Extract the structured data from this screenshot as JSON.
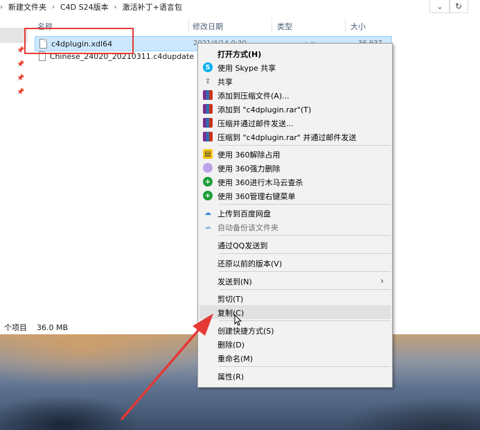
{
  "breadcrumb": {
    "items": [
      "新建文件夹",
      "C4D S24版本",
      "激活补丁+语言包"
    ]
  },
  "columns": {
    "name": "名称",
    "date": "修改日期",
    "type": "类型",
    "size": "大小"
  },
  "files": [
    {
      "name": "c4dplugin.xdl64",
      "date": "2021/4/14 0:30",
      "type": "XDL64 文件",
      "size": "36,937 KB"
    },
    {
      "name": "Chinese_24020_20210311.c4dupdate"
    }
  ],
  "status": {
    "items": "个项目",
    "selected_size": "36.0 MB"
  },
  "context_menu": {
    "open_with": "打开方式(H)",
    "skype": "使用 Skype 共享",
    "share": "共享",
    "add_archive": "添加到压缩文件(A)...",
    "add_rar": "添加到 \"c4dplugin.rar\"(T)",
    "compress_email": "压缩并通过邮件发送...",
    "compress_rar_email": "压缩到 \"c4dplugin.rar\" 并通过邮件发送",
    "unlock_360": "使用 360解除占用",
    "force_delete_360": "使用 360强力删除",
    "trojan_scan_360": "使用 360进行木马云查杀",
    "manage_menu_360": "使用 360管理右键菜单",
    "upload_baidu": "上传到百度网盘",
    "auto_backup": "自动备份该文件夹",
    "send_qq": "通过QQ发送到",
    "restore_prev": "还原以前的版本(V)",
    "send_to": "发送到(N)",
    "cut": "剪切(T)",
    "copy": "复制(C)",
    "create_shortcut": "创建快捷方式(S)",
    "delete": "删除(D)",
    "rename": "重命名(M)",
    "properties": "属性(R)"
  },
  "icons": {
    "skype": "S",
    "share": "⇪",
    "cloud": "☁",
    "refresh": "↻",
    "submenu": "›"
  },
  "colors": {
    "highlight": "#e53935",
    "selection": "#cce8ff",
    "menu_bg": "#f2f2f2"
  }
}
